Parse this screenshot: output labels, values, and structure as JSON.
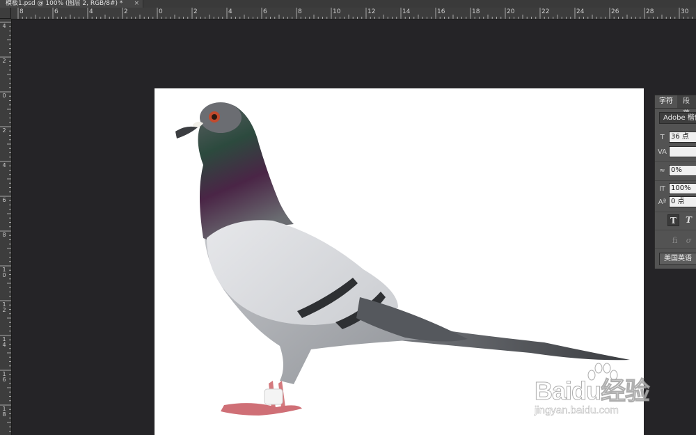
{
  "document": {
    "tab_title": "模板1.psd @ 100% (图层 2, RGB/8#) *",
    "close_glyph": "×"
  },
  "ruler": {
    "top_labels": [
      "8",
      "6",
      "4",
      "2",
      "0",
      "2",
      "4",
      "6",
      "8",
      "10",
      "12",
      "14",
      "16",
      "18",
      "20",
      "22",
      "24",
      "26",
      "28",
      "30"
    ],
    "left_labels": [
      "4",
      "2",
      "0",
      "2",
      "4",
      "6",
      "8",
      "10",
      "12",
      "14",
      "16",
      "18"
    ]
  },
  "character_panel": {
    "tabs": [
      "字符",
      "段落"
    ],
    "font_family": "Adobe 楷体",
    "font_size": "36 点",
    "kerning": "",
    "tracking": "0%",
    "vertical_scale": "100%",
    "baseline_shift": "0 点",
    "language": "美国英语",
    "icons": {
      "font_size": "font-size-icon",
      "kerning": "kerning-icon",
      "tracking": "tracking-icon",
      "vertical_scale": "vertical-scale-icon",
      "baseline": "baseline-shift-icon"
    }
  },
  "canvas": {
    "subject": "pigeon-image",
    "background": "#ffffff"
  },
  "watermark": {
    "brand": "Baidu经验",
    "url": "jingyan.baidu.com"
  }
}
